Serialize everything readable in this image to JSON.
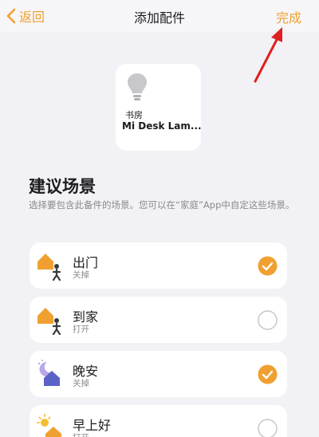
{
  "navbar": {
    "back_label": "返回",
    "title": "添加配件",
    "done_label": "完成",
    "accent_color": "#f0a030"
  },
  "accessory": {
    "room": "书房",
    "name": "Mi Desk Lam...",
    "icon": "lightbulb-icon"
  },
  "section": {
    "title": "建议场景",
    "description": "选择要包含此备件的场景。您可以在“家庭”App中自定这些场景。"
  },
  "scenes": [
    {
      "label": "出门",
      "sub": "关掉",
      "icon": "leave-home-icon",
      "selected": true
    },
    {
      "label": "到家",
      "sub": "打开",
      "icon": "arrive-home-icon",
      "selected": false
    },
    {
      "label": "晚安",
      "sub": "关掉",
      "icon": "good-night-icon",
      "selected": true
    },
    {
      "label": "早上好",
      "sub": "打开",
      "icon": "good-morning-icon",
      "selected": false
    }
  ]
}
